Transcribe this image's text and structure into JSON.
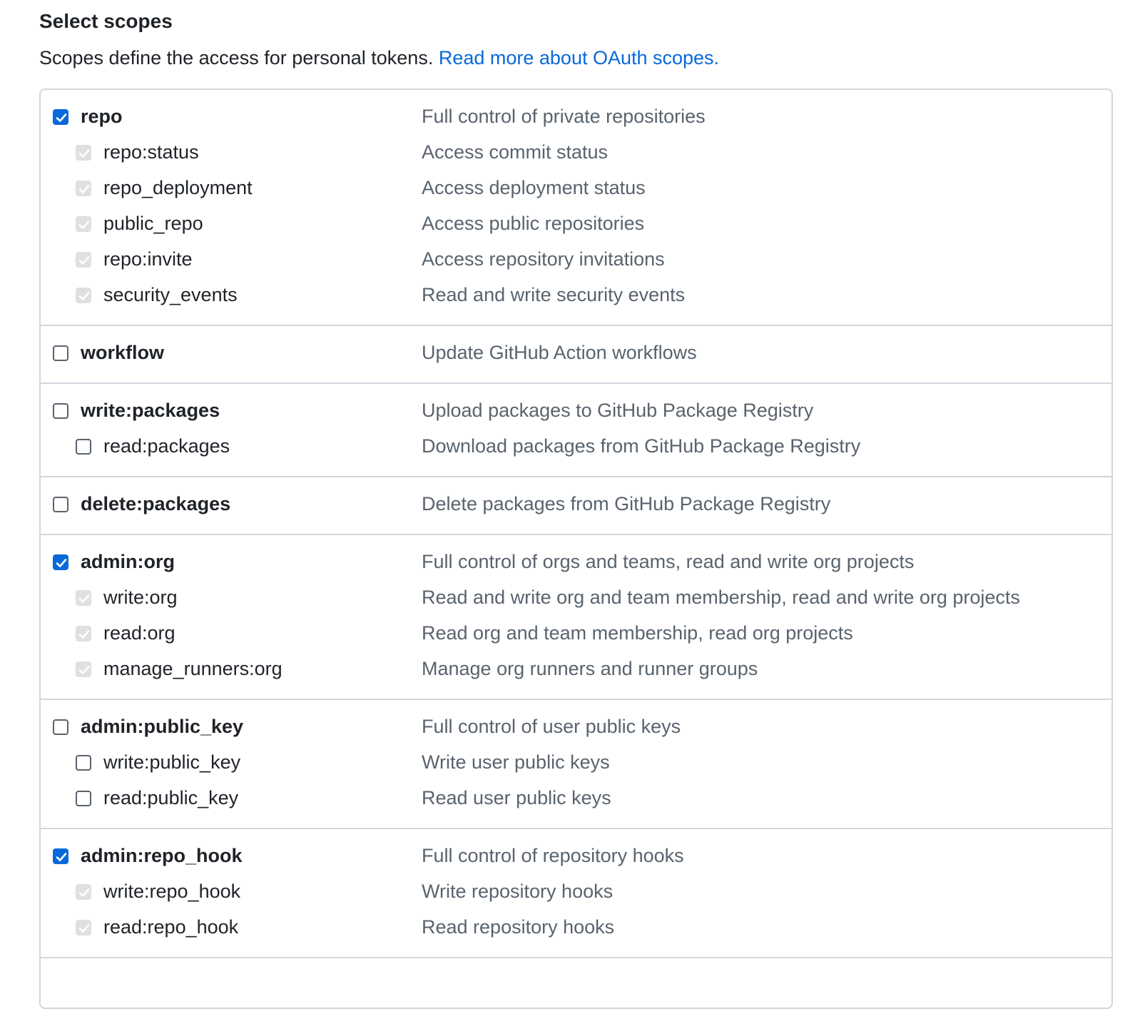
{
  "page": {
    "heading": "Select scopes",
    "intro_text": "Scopes define the access for personal tokens. ",
    "intro_link": "Read more about OAuth scopes."
  },
  "scope_groups": [
    {
      "parent": {
        "name": "repo",
        "description": "Full control of private repositories",
        "checked": true
      },
      "children": [
        {
          "name": "repo:status",
          "description": "Access commit status",
          "state": "implied"
        },
        {
          "name": "repo_deployment",
          "description": "Access deployment status",
          "state": "implied"
        },
        {
          "name": "public_repo",
          "description": "Access public repositories",
          "state": "implied"
        },
        {
          "name": "repo:invite",
          "description": "Access repository invitations",
          "state": "implied"
        },
        {
          "name": "security_events",
          "description": "Read and write security events",
          "state": "implied"
        }
      ]
    },
    {
      "parent": {
        "name": "workflow",
        "description": "Update GitHub Action workflows",
        "checked": false
      },
      "children": []
    },
    {
      "parent": {
        "name": "write:packages",
        "description": "Upload packages to GitHub Package Registry",
        "checked": false
      },
      "children": [
        {
          "name": "read:packages",
          "description": "Download packages from GitHub Package Registry",
          "state": "unchecked"
        }
      ]
    },
    {
      "parent": {
        "name": "delete:packages",
        "description": "Delete packages from GitHub Package Registry",
        "checked": false
      },
      "children": []
    },
    {
      "parent": {
        "name": "admin:org",
        "description": "Full control of orgs and teams, read and write org projects",
        "checked": true
      },
      "children": [
        {
          "name": "write:org",
          "description": "Read and write org and team membership, read and write org projects",
          "state": "implied"
        },
        {
          "name": "read:org",
          "description": "Read org and team membership, read org projects",
          "state": "implied"
        },
        {
          "name": "manage_runners:org",
          "description": "Manage org runners and runner groups",
          "state": "implied"
        }
      ]
    },
    {
      "parent": {
        "name": "admin:public_key",
        "description": "Full control of user public keys",
        "checked": false
      },
      "children": [
        {
          "name": "write:public_key",
          "description": "Write user public keys",
          "state": "unchecked"
        },
        {
          "name": "read:public_key",
          "description": "Read user public keys",
          "state": "unchecked"
        }
      ]
    },
    {
      "parent": {
        "name": "admin:repo_hook",
        "description": "Full control of repository hooks",
        "checked": true
      },
      "children": [
        {
          "name": "write:repo_hook",
          "description": "Write repository hooks",
          "state": "implied"
        },
        {
          "name": "read:repo_hook",
          "description": "Read repository hooks",
          "state": "implied"
        }
      ]
    }
  ],
  "colors": {
    "checkbox_checked": "#0969da",
    "checkbox_implied": "#e0e0e0",
    "link": "#0969da",
    "description_text": "#59636e",
    "border": "#d0d7de"
  },
  "icons": {
    "checked": "checkmark-icon",
    "implied": "checkmark-icon"
  }
}
